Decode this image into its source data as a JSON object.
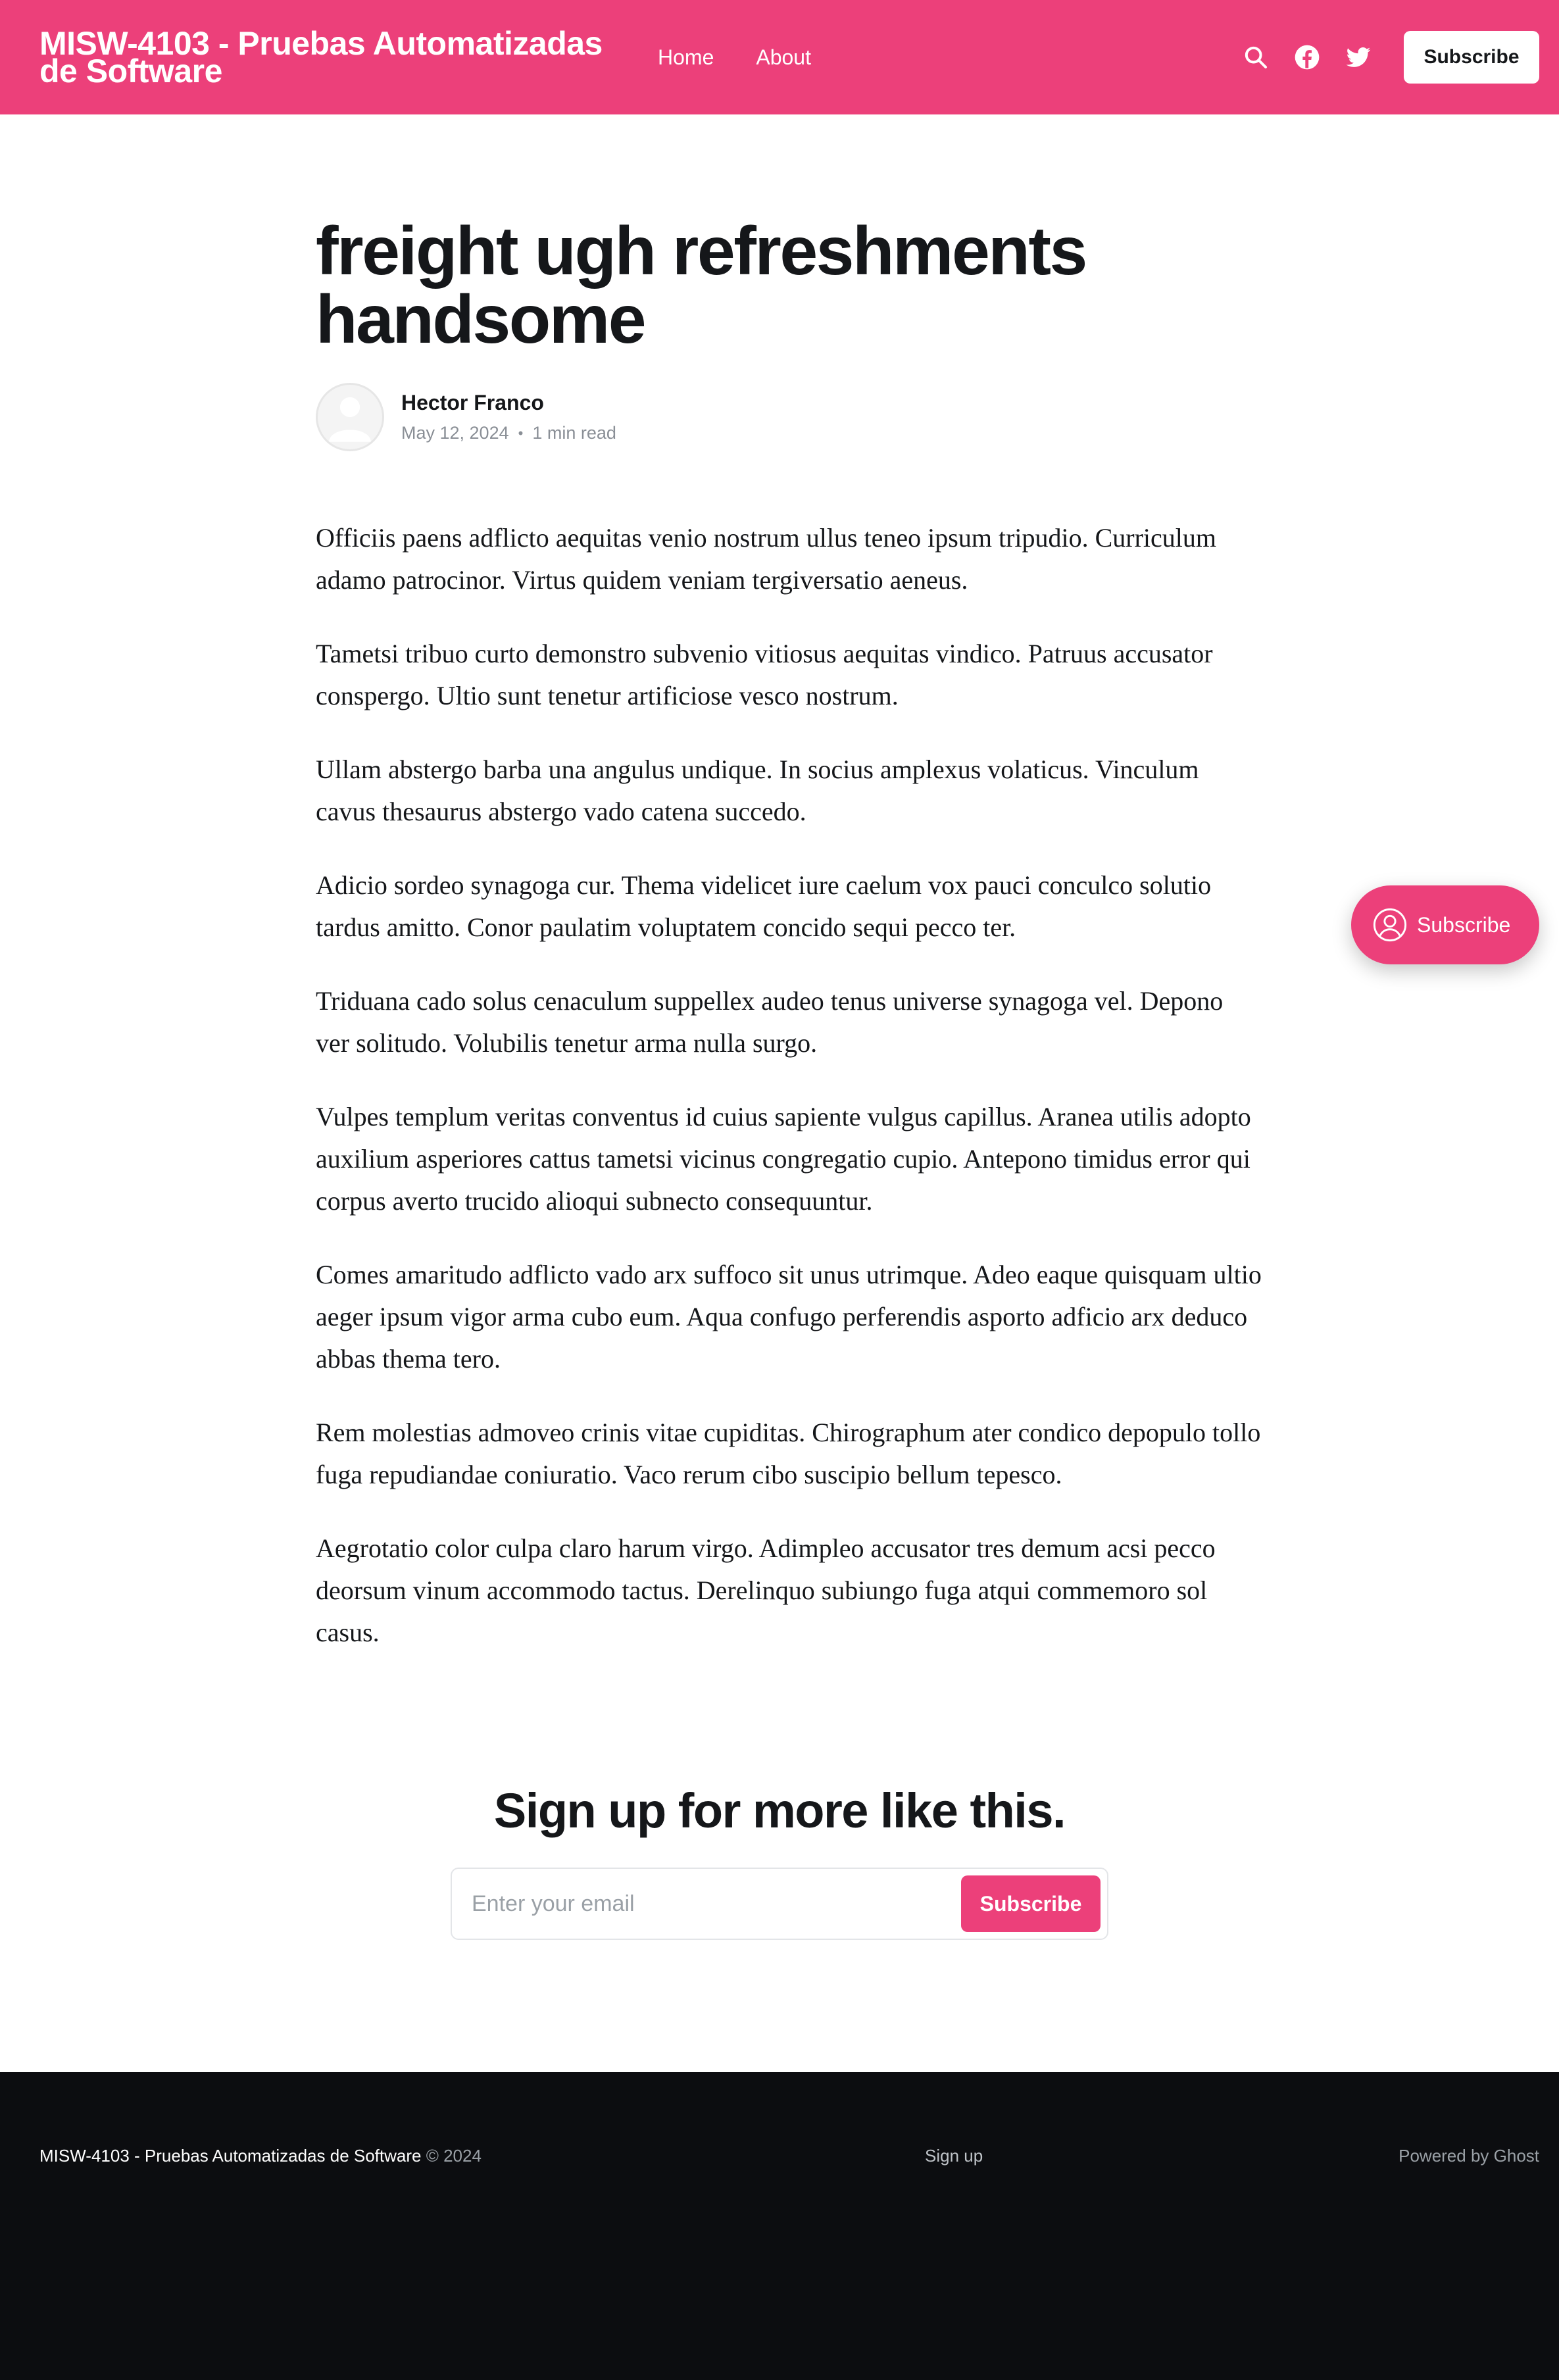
{
  "header": {
    "site_title": "MISW-4103 - Pruebas Automatizadas de Software",
    "nav": [
      "Home",
      "About"
    ],
    "subscribe_label": "Subscribe",
    "brand_color": "#ec407a",
    "icons": [
      "search-icon",
      "facebook-icon",
      "twitter-icon"
    ]
  },
  "post": {
    "title": "freight ugh refreshments handsome",
    "author": "Hector Franco",
    "date": "May 12, 2024",
    "separator": "•",
    "read_time": "1 min read",
    "paragraphs": [
      "Officiis paens adflicto aequitas venio nostrum ullus teneo ipsum tripudio. Curriculum adamo patrocinor. Virtus quidem veniam tergiversatio aeneus.",
      "Tametsi tribuo curto demonstro subvenio vitiosus aequitas vindico. Patruus accusator conspergo. Ultio sunt tenetur artificiose vesco nostrum.",
      "Ullam abstergo barba una angulus undique. In socius amplexus volaticus. Vinculum cavus thesaurus abstergo vado catena succedo.",
      "Adicio sordeo synagoga cur. Thema videlicet iure caelum vox pauci conculco solutio tardus amitto. Conor paulatim voluptatem concido sequi pecco ter.",
      "Triduana cado solus cenaculum suppellex audeo tenus universe synagoga vel. Depono ver solitudo. Volubilis tenetur arma nulla surgo.",
      "Vulpes templum veritas conventus id cuius sapiente vulgus capillus. Aranea utilis adopto auxilium asperiores cattus tametsi vicinus congregatio cupio. Antepono timidus error qui corpus averto trucido alioqui subnecto consequuntur.",
      "Comes amaritudo adflicto vado arx suffoco sit unus utrimque. Adeo eaque quisquam ultio aeger ipsum vigor arma cubo eum. Aqua confugo perferendis asporto adficio arx deduco abbas thema tero.",
      "Rem molestias admoveo crinis vitae cupiditas. Chirographum ater condico depopulo tollo fuga repudiandae coniuratio. Vaco rerum cibo suscipio bellum tepesco.",
      "Aegrotatio color culpa claro harum virgo. Adimpleo accusator tres demum acsi pecco deorsum vinum accommodo tactus. Derelinquo subiungo fuga atqui commemoro sol casus."
    ]
  },
  "cta": {
    "title": "Sign up for more like this.",
    "email_placeholder": "Enter your email",
    "button_label": "Subscribe"
  },
  "portal": {
    "label": "Subscribe"
  },
  "footer": {
    "site_name": "MISW-4103 - Pruebas Automatizadas de Software",
    "copyright": "© 2024",
    "signup_link": "Sign up",
    "powered_by": "Powered by Ghost"
  }
}
